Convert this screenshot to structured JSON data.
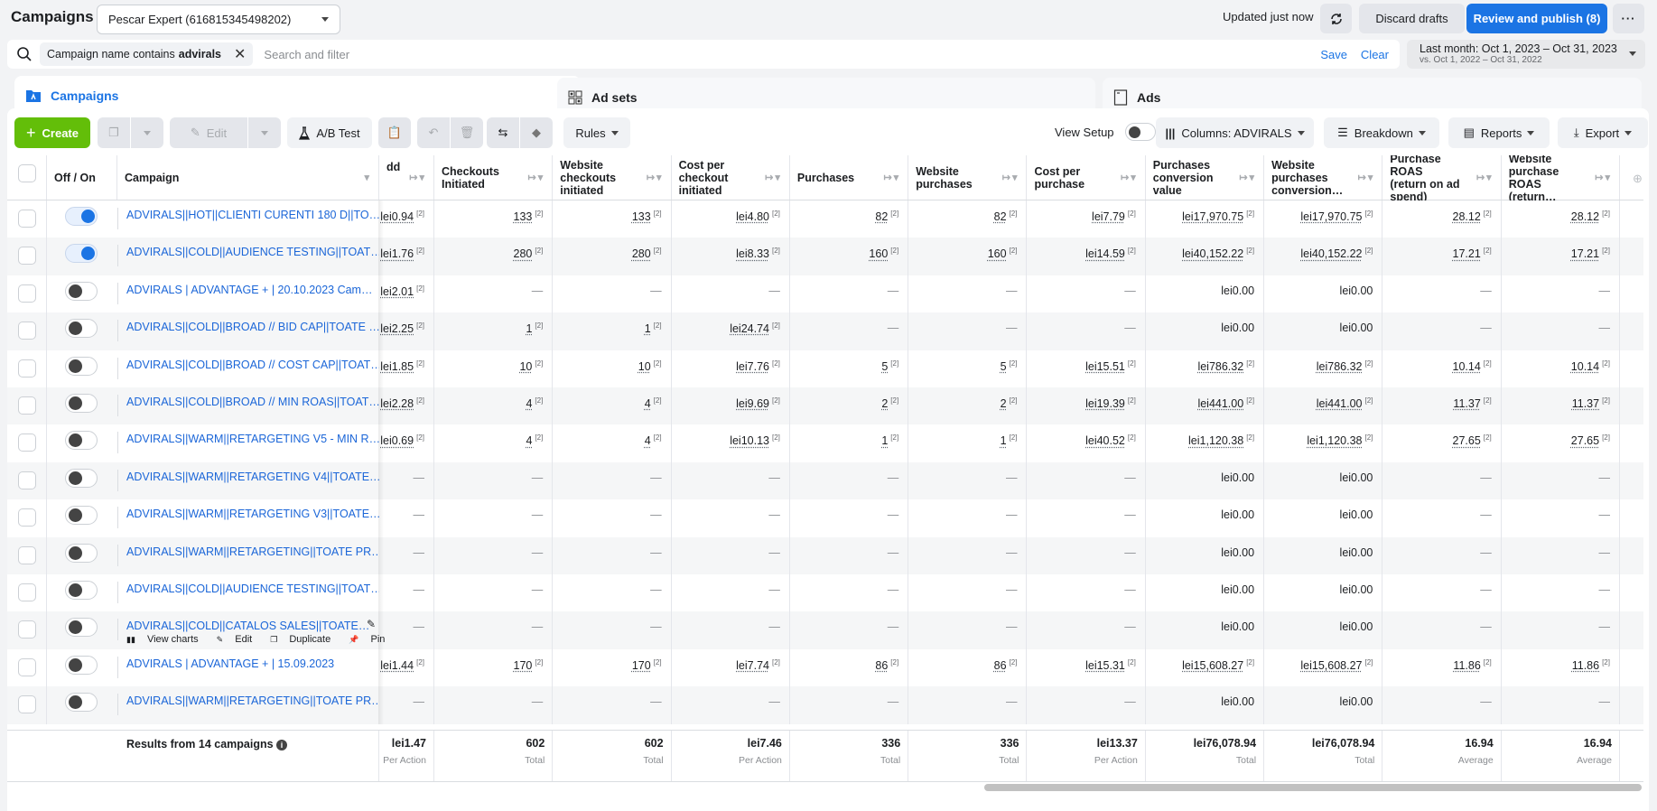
{
  "header": {
    "title": "Campaigns",
    "account": "Pescar Expert (616815345498202)",
    "updated": "Updated just now",
    "discard_label": "Discard drafts",
    "publish_label": "Review and publish (8)"
  },
  "filter": {
    "chip_prefix": "Campaign name contains",
    "chip_value": "advirals",
    "placeholder": "Search and filter",
    "save_label": "Save",
    "clear_label": "Clear"
  },
  "date_range": {
    "main": "Last month: Oct 1, 2023 – Oct 31, 2023",
    "compare": "vs. Oct 1, 2022 – Oct 31, 2022"
  },
  "tabs": [
    {
      "label": "Campaigns",
      "active": true
    },
    {
      "label": "Ad sets",
      "active": false
    },
    {
      "label": "Ads",
      "active": false
    }
  ],
  "toolbar": {
    "create_label": "Create",
    "edit_label": "Edit",
    "ab_test_label": "A/B Test",
    "rules_label": "Rules",
    "view_setup_label": "View Setup",
    "columns_label": "Columns: ADVIRALS",
    "breakdown_label": "Breakdown",
    "reports_label": "Reports",
    "export_label": "Export"
  },
  "table": {
    "headers": {
      "toggle": "Off / On",
      "campaign": "Campaign",
      "partial": "dd",
      "columns": [
        "Checkouts Initiated",
        "Website checkouts initiated",
        "Cost per checkout initiated",
        "Purchases",
        "Website purchases",
        "Cost per purchase",
        "Purchases conversion value",
        "Website purchases conversion…",
        "Purchase ROAS (return on ad spend)",
        "Website purchase ROAS (return…"
      ]
    },
    "rows": [
      {
        "on": true,
        "name": "ADVIRALS||HOT||CLIENTI CURENTI 180 D||TO…",
        "partial": "lei0.94",
        "values": [
          "133",
          "133",
          "lei4.80",
          "82",
          "82",
          "lei7.79",
          "lei17,970.75",
          "lei17,970.75",
          "28.12",
          "28.12"
        ]
      },
      {
        "on": true,
        "name": "ADVIRALS||COLD||AUDIENCE TESTING||TOAT…",
        "partial": "lei1.76",
        "values": [
          "280",
          "280",
          "lei8.33",
          "160",
          "160",
          "lei14.59",
          "lei40,152.22",
          "lei40,152.22",
          "17.21",
          "17.21"
        ]
      },
      {
        "on": false,
        "name": "ADVIRALS | ADVANTAGE + | 20.10.2023 Cam…",
        "partial": "lei2.01",
        "values": [
          "—",
          "—",
          "—",
          "—",
          "—",
          "—",
          "lei0.00",
          "lei0.00",
          "—",
          "—"
        ]
      },
      {
        "on": false,
        "name": "ADVIRALS||COLD||BROAD // BID CAP||TOATE …",
        "partial": "lei2.25",
        "values": [
          "1",
          "1",
          "lei24.74",
          "—",
          "—",
          "—",
          "lei0.00",
          "lei0.00",
          "—",
          "—"
        ]
      },
      {
        "on": false,
        "name": "ADVIRALS||COLD||BROAD // COST CAP||TOAT…",
        "partial": "lei1.85",
        "values": [
          "10",
          "10",
          "lei7.76",
          "5",
          "5",
          "lei15.51",
          "lei786.32",
          "lei786.32",
          "10.14",
          "10.14"
        ]
      },
      {
        "on": false,
        "name": "ADVIRALS||COLD||BROAD // MIN ROAS||TOAT…",
        "partial": "lei2.28",
        "values": [
          "4",
          "4",
          "lei9.69",
          "2",
          "2",
          "lei19.39",
          "lei441.00",
          "lei441.00",
          "11.37",
          "11.37"
        ]
      },
      {
        "on": false,
        "name": "ADVIRALS||WARM||RETARGETING V5 - MIN R…",
        "partial": "lei0.69",
        "values": [
          "4",
          "4",
          "lei10.13",
          "1",
          "1",
          "lei40.52",
          "lei1,120.38",
          "lei1,120.38",
          "27.65",
          "27.65"
        ]
      },
      {
        "on": false,
        "name": "ADVIRALS||WARM||RETARGETING V4||TOATE…",
        "partial": "—",
        "values": [
          "—",
          "—",
          "—",
          "—",
          "—",
          "—",
          "lei0.00",
          "lei0.00",
          "—",
          "—"
        ]
      },
      {
        "on": false,
        "name": "ADVIRALS||WARM||RETARGETING V3||TOATE…",
        "partial": "—",
        "values": [
          "—",
          "—",
          "—",
          "—",
          "—",
          "—",
          "lei0.00",
          "lei0.00",
          "—",
          "—"
        ]
      },
      {
        "on": false,
        "name": "ADVIRALS||WARM||RETARGETING||TOATE PR…",
        "partial": "—",
        "values": [
          "—",
          "—",
          "—",
          "—",
          "—",
          "—",
          "lei0.00",
          "lei0.00",
          "—",
          "—"
        ]
      },
      {
        "on": false,
        "name": "ADVIRALS||COLD||AUDIENCE TESTING||TOAT…",
        "partial": "—",
        "values": [
          "—",
          "—",
          "—",
          "—",
          "—",
          "—",
          "lei0.00",
          "lei0.00",
          "—",
          "—"
        ]
      },
      {
        "on": false,
        "name": "ADVIRALS||COLD||CATALOS SALES||TOATE…",
        "partial": "—",
        "values": [
          "—",
          "—",
          "—",
          "—",
          "—",
          "—",
          "lei0.00",
          "lei0.00",
          "—",
          "—"
        ],
        "hover_actions": [
          "View charts",
          "Edit",
          "Duplicate",
          "Pin"
        ]
      },
      {
        "on": false,
        "name": "ADVIRALS | ADVANTAGE + | 15.09.2023",
        "partial": "lei1.44",
        "values": [
          "170",
          "170",
          "lei7.74",
          "86",
          "86",
          "lei15.31",
          "lei15,608.27",
          "lei15,608.27",
          "11.86",
          "11.86"
        ]
      },
      {
        "on": false,
        "name": "ADVIRALS||WARM||RETARGETING||TOATE PR…",
        "partial": "—",
        "values": [
          "—",
          "—",
          "—",
          "—",
          "—",
          "—",
          "lei0.00",
          "lei0.00",
          "—",
          "—"
        ]
      }
    ],
    "footnote_marker": "[2]",
    "footer": {
      "results_label": "Results from 14 campaigns",
      "partial": {
        "value": "lei1.47",
        "label": "Per Action"
      },
      "cells": [
        {
          "value": "602",
          "label": "Total"
        },
        {
          "value": "602",
          "label": "Total"
        },
        {
          "value": "lei7.46",
          "label": "Per Action"
        },
        {
          "value": "336",
          "label": "Total"
        },
        {
          "value": "336",
          "label": "Total"
        },
        {
          "value": "lei13.37",
          "label": "Per Action"
        },
        {
          "value": "lei76,078.94",
          "label": "Total"
        },
        {
          "value": "lei76,078.94",
          "label": "Total"
        },
        {
          "value": "16.94",
          "label": "Average"
        },
        {
          "value": "16.94",
          "label": "Average"
        }
      ]
    }
  },
  "colors": {
    "accent": "#1b74e4",
    "create": "#63be09",
    "link": "#1b66d8"
  }
}
